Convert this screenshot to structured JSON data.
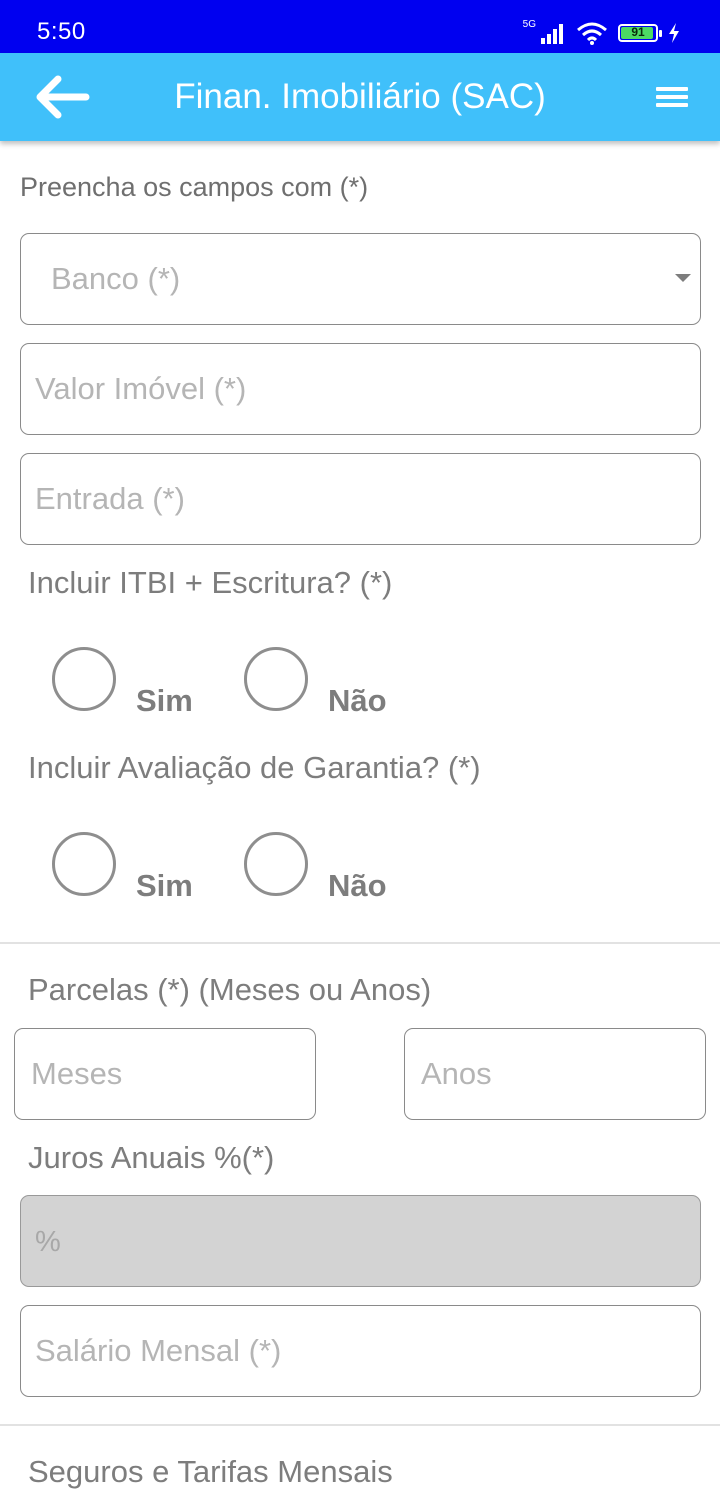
{
  "status_bar": {
    "time": "5:50",
    "network": "5G",
    "battery_level": "91",
    "icons": [
      "signal-icon",
      "wifi-icon",
      "battery-icon",
      "charging-icon"
    ]
  },
  "app_bar": {
    "title": "Finan. Imobiliário (SAC)",
    "back_icon": "arrow-left-icon",
    "menu_icon": "hamburger-menu-icon",
    "color": "#40c0fa"
  },
  "form": {
    "intro": "Preencha os campos com (*)",
    "banco": {
      "placeholder": "Banco (*)"
    },
    "valor_imovel": {
      "placeholder": "Valor Imóvel (*)"
    },
    "entrada": {
      "placeholder": "Entrada (*)"
    },
    "itbi": {
      "question": "Incluir ITBI + Escritura? (*)",
      "options": [
        "Sim",
        "Não"
      ]
    },
    "garantia": {
      "question": "Incluir Avaliação de Garantia? (*)",
      "options": [
        "Sim",
        "Não"
      ]
    },
    "parcelas": {
      "label": "Parcelas (*) (Meses ou Anos)",
      "meses_placeholder": "Meses",
      "anos_placeholder": "Anos"
    },
    "juros": {
      "label": "Juros Anuais %(*)",
      "placeholder": "%"
    },
    "salario": {
      "placeholder": "Salário Mensal (*)"
    },
    "seguros_label": "Seguros e Tarifas Mensais"
  }
}
